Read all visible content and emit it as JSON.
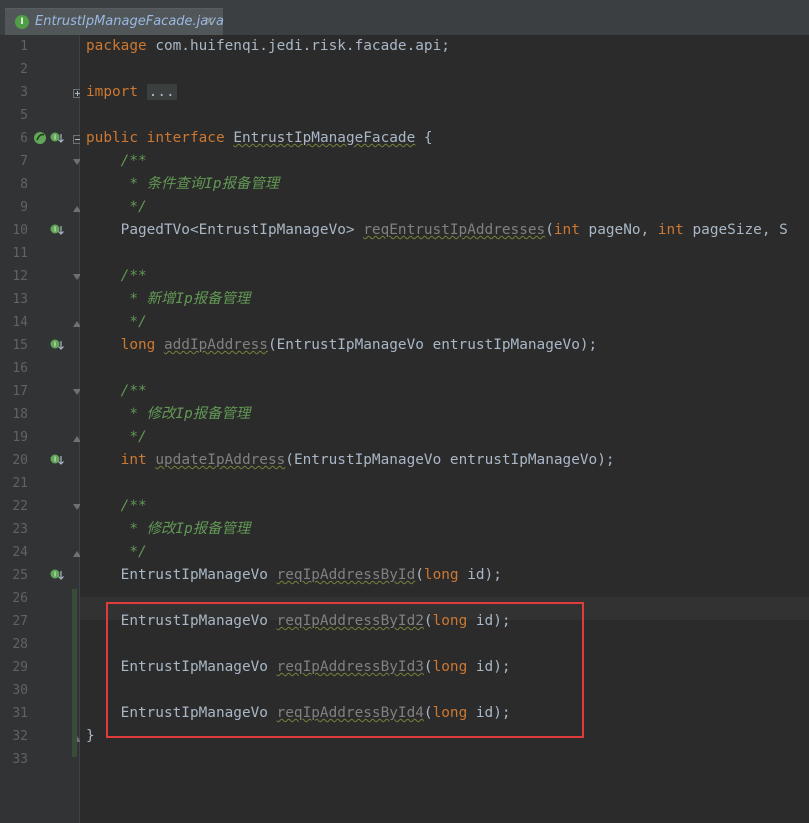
{
  "tab": {
    "label": "EntrustIpManageFacade.java",
    "close": "×",
    "icon": "I"
  },
  "line_numbers": [
    "1",
    "2",
    "3",
    "5",
    "6",
    "7",
    "8",
    "9",
    "10",
    "11",
    "12",
    "13",
    "14",
    "15",
    "16",
    "17",
    "18",
    "19",
    "20",
    "21",
    "22",
    "23",
    "24",
    "25",
    "26",
    "27",
    "28",
    "29",
    "30",
    "31",
    "32",
    "33"
  ],
  "code": {
    "l1": {
      "a": "package",
      "b": " com.huifenqi.jedi.risk.facade.api;"
    },
    "l3": {
      "a": "import",
      "b": " ",
      "c": "..."
    },
    "l6": {
      "a": "public",
      "b": " ",
      "c": "interface",
      "d": " ",
      "e": "EntrustIpManageFacade",
      "f": " {"
    },
    "l7": "    /**",
    "l8": "     * 条件查询Ip报备管理",
    "l9": "     */",
    "l10": {
      "a": "    PagedTVo<EntrustIpManageVo> ",
      "b": "reqEntrustIpAddresses",
      "c": "(",
      "d": "int",
      "e": " pageNo, ",
      "f": "int",
      "g": " pageSize, S"
    },
    "l12": "    /**",
    "l13": "     * 新增Ip报备管理",
    "l14": "     */",
    "l15": {
      "a": "    ",
      "b": "long",
      "c": " ",
      "d": "addIpAddress",
      "e": "(EntrustIpManageVo entrustIpManageVo);"
    },
    "l17": "    /**",
    "l18": "     * 修改Ip报备管理",
    "l19": "     */",
    "l20": {
      "a": "    ",
      "b": "int",
      "c": " ",
      "d": "updateIpAddress",
      "e": "(EntrustIpManageVo entrustIpManageVo);"
    },
    "l22": "    /**",
    "l23": "     * 修改Ip报备管理",
    "l24": "     */",
    "l25": {
      "a": "    EntrustIpManageVo ",
      "b": "reqIpAddressById",
      "c": "(",
      "d": "long",
      "e": " id);"
    },
    "l27": {
      "a": "    EntrustIpManageVo ",
      "b": "reqIpAddressById2",
      "c": "(",
      "d": "long",
      "e": " id);"
    },
    "l29": {
      "a": "    EntrustIpManageVo ",
      "b": "reqIpAddressById3",
      "c": "(",
      "d": "long",
      "e": " id);"
    },
    "l31": {
      "a": "    EntrustIpManageVo ",
      "b": "reqIpAddressById4",
      "c": "(",
      "d": "long",
      "e": " id);"
    },
    "l32": "}"
  },
  "gutter_icons": {
    "implemented": "implemented-icon",
    "spring_bean": "bean-icon"
  }
}
